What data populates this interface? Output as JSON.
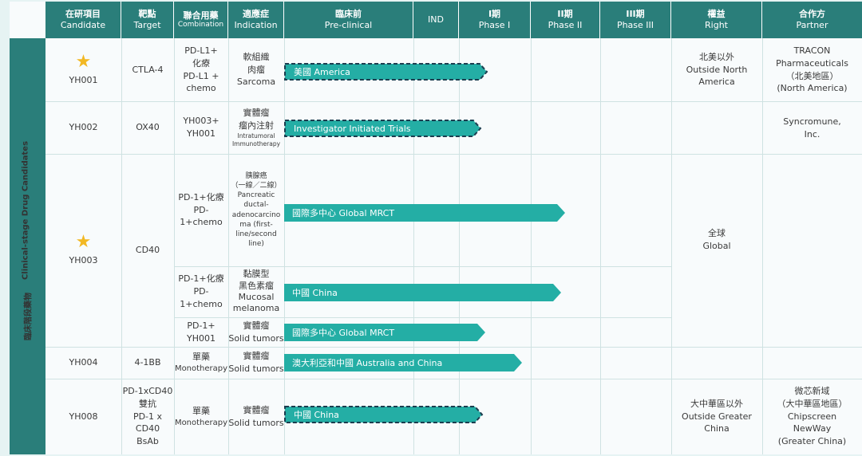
{
  "headers": {
    "candidate": {
      "zh": "在研項目",
      "en": "Candidate"
    },
    "target": {
      "zh": "靶點",
      "en": "Target"
    },
    "combination": {
      "zh": "聯合用藥",
      "en": "Combination"
    },
    "indication": {
      "zh": "適應症",
      "en": "Indication"
    },
    "preclinical": {
      "zh": "臨床前",
      "en": "Pre-clinical"
    },
    "ind": {
      "en": "IND"
    },
    "phase1": {
      "zh": "I期",
      "en": "Phase I"
    },
    "phase2": {
      "zh": "II期",
      "en": "Phase II"
    },
    "phase3": {
      "zh": "III期",
      "en": "Phase III"
    },
    "right": {
      "zh": "權益",
      "en": "Right"
    },
    "partner": {
      "zh": "合作方",
      "en": "Partner"
    }
  },
  "side_label": {
    "en": "Clinical-stage Drug Candidates",
    "zh": "臨床階段藥物"
  },
  "rows": [
    {
      "candidate": "YH001",
      "target": "CTLA-4",
      "combination": [
        "PD-L1+",
        "化療",
        "PD-L1 +",
        "chemo"
      ],
      "indication": [
        "軟組織",
        "肉瘤",
        "Sarcoma"
      ],
      "bar": "美國 America",
      "right": [
        "北美以外",
        "Outside North",
        "America"
      ],
      "partner": [
        "TRACON",
        "Pharmaceuticals",
        "（北美地區）",
        "(North America)"
      ]
    },
    {
      "candidate": "YH002",
      "target": "OX40",
      "combination": [
        "YH003+",
        "YH001"
      ],
      "indication": [
        "實體瘤",
        "瘤內注射"
      ],
      "indication_small": [
        "Intratumoral",
        "Immunotherapy"
      ],
      "bar": "Investigator Initiated Trials",
      "partner": [
        "Syncromune,",
        "Inc."
      ]
    },
    {
      "candidate": "YH003",
      "target": "CD40",
      "sub": [
        {
          "combination": [
            "PD-1+化療",
            "PD-",
            "1+chemo"
          ],
          "indication_zh": [
            "胰腺癌",
            "（一線／二線）"
          ],
          "indication_en": [
            "Pancreatic",
            "ductal-",
            "adenocarcino",
            "ma (first-",
            "line/second",
            "line)"
          ],
          "bar": "國際多中心 Global MRCT"
        },
        {
          "combination": [
            "PD-1+化療",
            "PD-",
            "1+chemo"
          ],
          "indication": [
            "黏膜型",
            "黑色素瘤",
            "Mucosal",
            "melanoma"
          ],
          "bar": "中國 China"
        },
        {
          "combination": [
            "PD-1+",
            "YH001"
          ],
          "indication": [
            "實體瘤",
            "Solid tumors"
          ],
          "bar": "國際多中心 Global MRCT"
        }
      ],
      "right": [
        "全球",
        "Global"
      ]
    },
    {
      "candidate": "YH004",
      "target": "4-1BB",
      "combination": [
        "單藥",
        "Monotherapy"
      ],
      "indication": [
        "實體瘤",
        "Solid tumors"
      ],
      "bar": "澳大利亞和中國 Australia and China"
    },
    {
      "candidate": "YH008",
      "target": [
        "PD-1xCD40",
        "雙抗",
        "PD-1 x CD40",
        "BsAb"
      ],
      "combination": [
        "單藥",
        "Monotherapy"
      ],
      "indication": [
        "實體瘤",
        "Solid tumors"
      ],
      "bar": "中國 China",
      "right": [
        "大中華區以外",
        "Outside Greater",
        "China"
      ],
      "partner": [
        "微芯新域",
        "（大中華區地區）",
        "Chipscreen",
        "NewWay",
        "(Greater China)"
      ]
    }
  ],
  "colors": {
    "header": "#2a7e7a",
    "bar": "#24aea5",
    "bar_dashed_border": "#1b3d4f",
    "star": "#f2b824",
    "grid": "#cfe2e2"
  }
}
